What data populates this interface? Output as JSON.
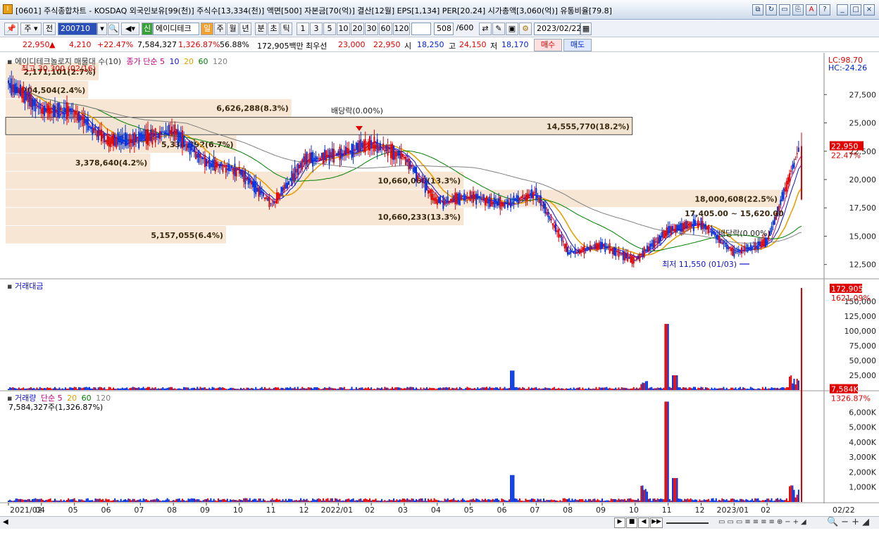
{
  "window": {
    "title": "[0601] 주식종합차트 - KOSDAQ 외국인보유[99(천)] 주식수[13,334(천)] 액면[500] 자본금[70(억)] 결산[12월] EPS[1,134] PER[20.24] 시가총액[3,060(억)] 유통비율[79.8]",
    "icon_label": "I",
    "buttons": [
      "⧉",
      "↻",
      "▭",
      "⎘",
      "A",
      "?",
      "_",
      "□",
      "×"
    ]
  },
  "toolbar": {
    "type_select": "주",
    "prev_label": "전",
    "code_value": "200710",
    "stock_name": "에이디테크",
    "new_label": "신",
    "periods": [
      "일",
      "주",
      "월",
      "년",
      "분",
      "초",
      "틱"
    ],
    "active_period": "일",
    "intervals": [
      "1",
      "3",
      "5",
      "10",
      "20",
      "30",
      "60",
      "120"
    ],
    "count_value": "508",
    "count_total": "/600",
    "date_value": "2023/02/22"
  },
  "pricebar": {
    "price": "22,950",
    "change_arrow": "▲",
    "change": "4,210",
    "change_pct": "+22.47%",
    "volume": "7,584,327",
    "volume_pct": "1,326.87%",
    "volume_ratio": "56.88%",
    "amount": "172,905백만",
    "priority_label": "최우선",
    "ask": "23,000",
    "bid": "22,950",
    "open_label": "시",
    "open": "18,250",
    "high_label": "고",
    "high": "24,150",
    "low_label": "저",
    "low": "18,170",
    "buy_label": "매수",
    "sell_label": "매도"
  },
  "price_panel": {
    "legend_name": "에이디테크놀로지 매물대 수(10)",
    "legend_ma": "종가 단순 5",
    "ma_periods": [
      "10",
      "20",
      "60",
      "120"
    ],
    "ma_colors": [
      "#c00080",
      "#1010d0",
      "#e8a000",
      "#008000",
      "#808080"
    ],
    "lc_label": "LC:98.70",
    "hc_label": "HC:-24.26",
    "high_annotation": "최고 30,300 (02/16)",
    "low_annotation": "최저 11,550 (01/03)",
    "dividend_label": "배당락(0.00%)",
    "dividend_label2": "배당락(0.00%)",
    "current_price_tag": "22,950",
    "current_pct_tag": "22.47%",
    "range_label": "17,405.00 ~ 15,620.00",
    "yticks": [
      "27,500",
      "25,000",
      "22,500",
      "20,000",
      "17,500",
      "15,000",
      "12,500"
    ],
    "profile": [
      {
        "price_top": 30300,
        "price_bottom": 28700,
        "label": "2,171,101(2.7%)",
        "share": 2.7
      },
      {
        "price_top": 28700,
        "price_bottom": 27100,
        "label": "1,904,504(2.4%)",
        "share": 2.4
      },
      {
        "price_top": 27100,
        "price_bottom": 25500,
        "label": "6,626,288(8.3%)",
        "share": 8.3
      },
      {
        "price_top": 25500,
        "price_bottom": 23900,
        "label": "14,555,770(18.2%)",
        "share": 18.2
      },
      {
        "price_top": 23900,
        "price_bottom": 22300,
        "label": "5,334,392(6.7%)",
        "share": 6.7
      },
      {
        "price_top": 22300,
        "price_bottom": 20700,
        "label": "3,378,640(4.2%)",
        "share": 4.2
      },
      {
        "price_top": 20700,
        "price_bottom": 19100,
        "label": "10,660,060(13.3%)",
        "share": 13.3
      },
      {
        "price_top": 19100,
        "price_bottom": 17500,
        "label": "18,000,608(22.5%)",
        "share": 22.5
      },
      {
        "price_top": 17500,
        "price_bottom": 15900,
        "label": "10,660,233(13.3%)",
        "share": 13.3
      },
      {
        "price_top": 15900,
        "price_bottom": 14300,
        "label": "5,157,055(6.4%)",
        "share": 6.4
      }
    ]
  },
  "amount_panel": {
    "legend": "거래대금",
    "tag_value": "172,905",
    "tag_pct": "1621.09%",
    "yticks": [
      "150,000",
      "125,000",
      "100,000",
      "75,000",
      "50,000",
      "25,000"
    ]
  },
  "volume_panel": {
    "legend_name": "거래량",
    "legend_ma": "단순 5",
    "ma_periods": [
      "20",
      "60",
      "120"
    ],
    "sub_legend": "7,584,327주(1,326.87%)",
    "tag_value": "7,584K",
    "tag_pct": "1326.87%",
    "yticks": [
      "6,000K",
      "5,000K",
      "4,000K",
      "3,000K",
      "2,000K",
      "1,000K"
    ]
  },
  "x_axis": {
    "labels": [
      "2021/02",
      "04",
      "05",
      "06",
      "07",
      "08",
      "09",
      "10",
      "11",
      "12",
      "2022/01",
      "02",
      "03",
      "04",
      "05",
      "06",
      "07",
      "08",
      "09",
      "10",
      "11",
      "12",
      "2023/01",
      "02"
    ],
    "right_label": "02/22"
  },
  "chart_data": {
    "type": "candlestick",
    "series_close_approx": [
      {
        "date": "2021/02",
        "value": 28500
      },
      {
        "date": "2021/03",
        "value": 26200
      },
      {
        "date": "2021/04",
        "value": 26000
      },
      {
        "date": "2021/05",
        "value": 23400
      },
      {
        "date": "2021/06",
        "value": 23600
      },
      {
        "date": "2021/07",
        "value": 24200
      },
      {
        "date": "2021/08",
        "value": 21500
      },
      {
        "date": "2021/09",
        "value": 20800
      },
      {
        "date": "2021/10",
        "value": 17800
      },
      {
        "date": "2021/11",
        "value": 21800
      },
      {
        "date": "2021/12",
        "value": 22200
      },
      {
        "date": "2022/01",
        "value": 23200
      },
      {
        "date": "2022/02",
        "value": 22000
      },
      {
        "date": "2022/03",
        "value": 18000
      },
      {
        "date": "2022/04",
        "value": 18500
      },
      {
        "date": "2022/05",
        "value": 17800
      },
      {
        "date": "2022/06",
        "value": 18800
      },
      {
        "date": "2022/07",
        "value": 13500
      },
      {
        "date": "2022/08",
        "value": 14200
      },
      {
        "date": "2022/09",
        "value": 12800
      },
      {
        "date": "2022/10",
        "value": 15500
      },
      {
        "date": "2022/11",
        "value": 16200
      },
      {
        "date": "2022/12",
        "value": 13500
      },
      {
        "date": "2023/01",
        "value": 14500
      },
      {
        "date": "2023/02",
        "value": 22950
      }
    ],
    "high": 30300,
    "low": 11550,
    "last_close": 22950
  },
  "statusbar": {
    "nav_buttons": [
      "▶",
      "■",
      "◀",
      "▶▶"
    ]
  }
}
